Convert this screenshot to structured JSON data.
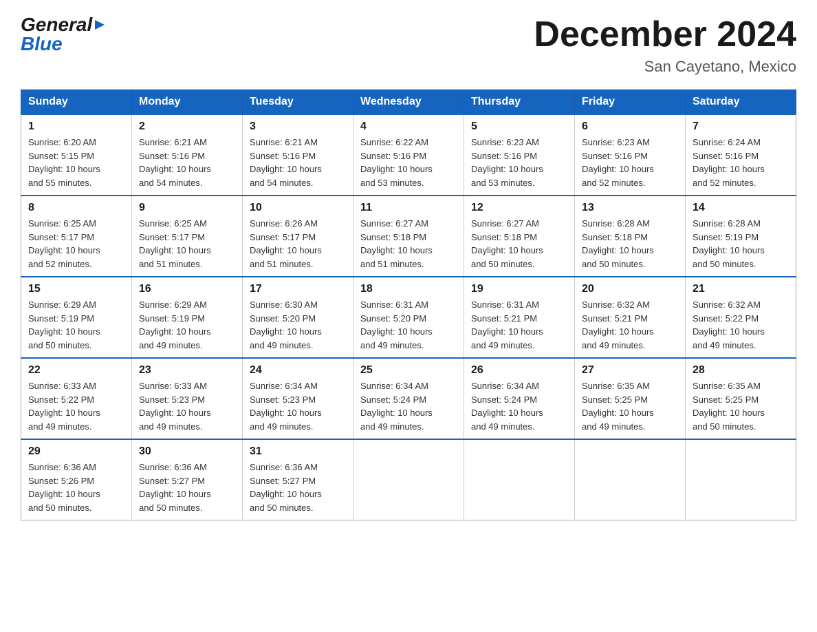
{
  "header": {
    "logo_general": "General",
    "logo_blue": "Blue",
    "month_title": "December 2024",
    "location": "San Cayetano, Mexico"
  },
  "weekdays": [
    "Sunday",
    "Monday",
    "Tuesday",
    "Wednesday",
    "Thursday",
    "Friday",
    "Saturday"
  ],
  "weeks": [
    [
      {
        "day": "1",
        "sunrise": "6:20 AM",
        "sunset": "5:15 PM",
        "daylight": "10 hours and 55 minutes."
      },
      {
        "day": "2",
        "sunrise": "6:21 AM",
        "sunset": "5:16 PM",
        "daylight": "10 hours and 54 minutes."
      },
      {
        "day": "3",
        "sunrise": "6:21 AM",
        "sunset": "5:16 PM",
        "daylight": "10 hours and 54 minutes."
      },
      {
        "day": "4",
        "sunrise": "6:22 AM",
        "sunset": "5:16 PM",
        "daylight": "10 hours and 53 minutes."
      },
      {
        "day": "5",
        "sunrise": "6:23 AM",
        "sunset": "5:16 PM",
        "daylight": "10 hours and 53 minutes."
      },
      {
        "day": "6",
        "sunrise": "6:23 AM",
        "sunset": "5:16 PM",
        "daylight": "10 hours and 52 minutes."
      },
      {
        "day": "7",
        "sunrise": "6:24 AM",
        "sunset": "5:16 PM",
        "daylight": "10 hours and 52 minutes."
      }
    ],
    [
      {
        "day": "8",
        "sunrise": "6:25 AM",
        "sunset": "5:17 PM",
        "daylight": "10 hours and 52 minutes."
      },
      {
        "day": "9",
        "sunrise": "6:25 AM",
        "sunset": "5:17 PM",
        "daylight": "10 hours and 51 minutes."
      },
      {
        "day": "10",
        "sunrise": "6:26 AM",
        "sunset": "5:17 PM",
        "daylight": "10 hours and 51 minutes."
      },
      {
        "day": "11",
        "sunrise": "6:27 AM",
        "sunset": "5:18 PM",
        "daylight": "10 hours and 51 minutes."
      },
      {
        "day": "12",
        "sunrise": "6:27 AM",
        "sunset": "5:18 PM",
        "daylight": "10 hours and 50 minutes."
      },
      {
        "day": "13",
        "sunrise": "6:28 AM",
        "sunset": "5:18 PM",
        "daylight": "10 hours and 50 minutes."
      },
      {
        "day": "14",
        "sunrise": "6:28 AM",
        "sunset": "5:19 PM",
        "daylight": "10 hours and 50 minutes."
      }
    ],
    [
      {
        "day": "15",
        "sunrise": "6:29 AM",
        "sunset": "5:19 PM",
        "daylight": "10 hours and 50 minutes."
      },
      {
        "day": "16",
        "sunrise": "6:29 AM",
        "sunset": "5:19 PM",
        "daylight": "10 hours and 49 minutes."
      },
      {
        "day": "17",
        "sunrise": "6:30 AM",
        "sunset": "5:20 PM",
        "daylight": "10 hours and 49 minutes."
      },
      {
        "day": "18",
        "sunrise": "6:31 AM",
        "sunset": "5:20 PM",
        "daylight": "10 hours and 49 minutes."
      },
      {
        "day": "19",
        "sunrise": "6:31 AM",
        "sunset": "5:21 PM",
        "daylight": "10 hours and 49 minutes."
      },
      {
        "day": "20",
        "sunrise": "6:32 AM",
        "sunset": "5:21 PM",
        "daylight": "10 hours and 49 minutes."
      },
      {
        "day": "21",
        "sunrise": "6:32 AM",
        "sunset": "5:22 PM",
        "daylight": "10 hours and 49 minutes."
      }
    ],
    [
      {
        "day": "22",
        "sunrise": "6:33 AM",
        "sunset": "5:22 PM",
        "daylight": "10 hours and 49 minutes."
      },
      {
        "day": "23",
        "sunrise": "6:33 AM",
        "sunset": "5:23 PM",
        "daylight": "10 hours and 49 minutes."
      },
      {
        "day": "24",
        "sunrise": "6:34 AM",
        "sunset": "5:23 PM",
        "daylight": "10 hours and 49 minutes."
      },
      {
        "day": "25",
        "sunrise": "6:34 AM",
        "sunset": "5:24 PM",
        "daylight": "10 hours and 49 minutes."
      },
      {
        "day": "26",
        "sunrise": "6:34 AM",
        "sunset": "5:24 PM",
        "daylight": "10 hours and 49 minutes."
      },
      {
        "day": "27",
        "sunrise": "6:35 AM",
        "sunset": "5:25 PM",
        "daylight": "10 hours and 49 minutes."
      },
      {
        "day": "28",
        "sunrise": "6:35 AM",
        "sunset": "5:25 PM",
        "daylight": "10 hours and 50 minutes."
      }
    ],
    [
      {
        "day": "29",
        "sunrise": "6:36 AM",
        "sunset": "5:26 PM",
        "daylight": "10 hours and 50 minutes."
      },
      {
        "day": "30",
        "sunrise": "6:36 AM",
        "sunset": "5:27 PM",
        "daylight": "10 hours and 50 minutes."
      },
      {
        "day": "31",
        "sunrise": "6:36 AM",
        "sunset": "5:27 PM",
        "daylight": "10 hours and 50 minutes."
      },
      null,
      null,
      null,
      null
    ]
  ],
  "labels": {
    "sunrise": "Sunrise:",
    "sunset": "Sunset:",
    "daylight": "Daylight:"
  }
}
